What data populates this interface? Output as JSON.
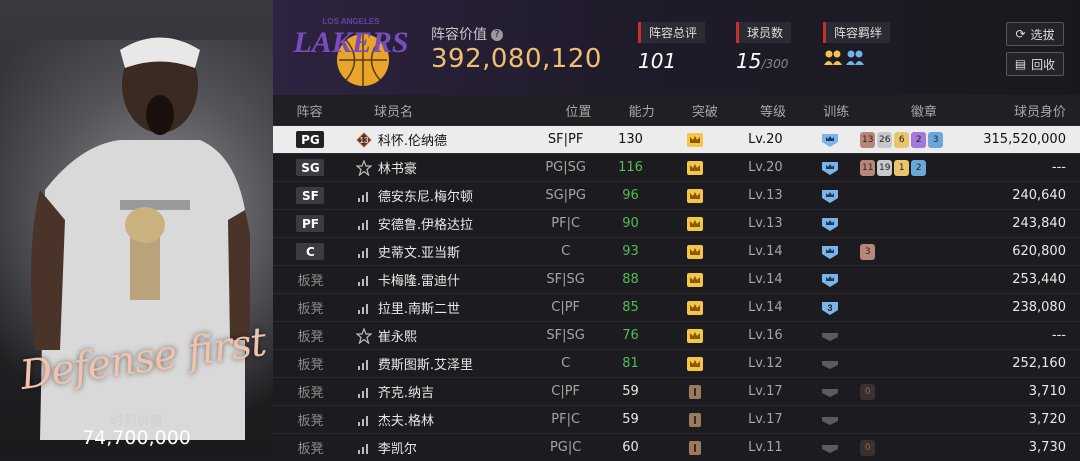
{
  "left_panel": {
    "script_text": "Defense first",
    "market_value_label": "时刻价值",
    "market_value": "74,700,000"
  },
  "header": {
    "logo_text": "LAKERS",
    "logo_city": "LOS ANGELES",
    "team_value_label": "阵容价值",
    "team_value": "392,080,120",
    "rating_label": "阵容总评",
    "rating_value": "101",
    "roster_label": "球员数",
    "roster_value": "15",
    "roster_max": "/300",
    "chem_label": "阵容羁绊",
    "filter_button": "选拔",
    "recycle_button": "回收"
  },
  "table": {
    "headers": {
      "lineup": "阵容",
      "name": "球员名",
      "position": "位置",
      "rating": "能力",
      "breakthrough": "突破",
      "level": "等级",
      "training": "训练",
      "badges": "徽章",
      "value": "球员身价"
    },
    "rows": [
      {
        "slot": "PG",
        "name": "科怀.伦纳德",
        "pos": "SF|PF",
        "rating": "130",
        "level": "Lv.20",
        "value": "315,520,000"
      },
      {
        "slot": "SG",
        "name": "林书豪",
        "pos": "PG|SG",
        "rating": "116",
        "level": "Lv.20",
        "value": "---"
      },
      {
        "slot": "SF",
        "name": "德安东尼.梅尔顿",
        "pos": "SG|PG",
        "rating": "96",
        "level": "Lv.13",
        "value": "240,640"
      },
      {
        "slot": "PF",
        "name": "安德鲁.伊格达拉",
        "pos": "PF|C",
        "rating": "90",
        "level": "Lv.13",
        "value": "243,840"
      },
      {
        "slot": "C",
        "name": "史蒂文.亚当斯",
        "pos": "C",
        "rating": "93",
        "level": "Lv.14",
        "value": "620,800"
      },
      {
        "slot": "板凳",
        "name": "卡梅隆.雷迪什",
        "pos": "SF|SG",
        "rating": "88",
        "level": "Lv.14",
        "value": "253,440"
      },
      {
        "slot": "板凳",
        "name": "拉里.南斯二世",
        "pos": "C|PF",
        "rating": "85",
        "level": "Lv.14",
        "value": "238,080"
      },
      {
        "slot": "板凳",
        "name": "崔永熙",
        "pos": "SF|SG",
        "rating": "76",
        "level": "Lv.16",
        "value": "---"
      },
      {
        "slot": "板凳",
        "name": "费斯图斯.艾泽里",
        "pos": "C",
        "rating": "81",
        "level": "Lv.12",
        "value": "252,160"
      },
      {
        "slot": "板凳",
        "name": "齐克.纳吉",
        "pos": "C|PF",
        "rating": "59",
        "level": "Lv.17",
        "value": "3,710"
      },
      {
        "slot": "板凳",
        "name": "杰夫.格林",
        "pos": "PF|C",
        "rating": "59",
        "level": "Lv.17",
        "value": "3,720"
      },
      {
        "slot": "板凳",
        "name": "李凯尔",
        "pos": "PG|C",
        "rating": "60",
        "level": "Lv.11",
        "value": "3,730"
      }
    ],
    "row0_badges": [
      "13",
      "26",
      "6",
      "2",
      "3"
    ],
    "row1_badges": [
      "11",
      "19",
      "1",
      "2"
    ],
    "row0_star": "13",
    "training_number": "3",
    "badge_small": "3",
    "badge_zero": "0"
  },
  "colors": {
    "accent_gold": "#f0c070",
    "rating_green": "#4fbf4f",
    "selected_row": "#ececec",
    "label_red": "#c9302c"
  }
}
